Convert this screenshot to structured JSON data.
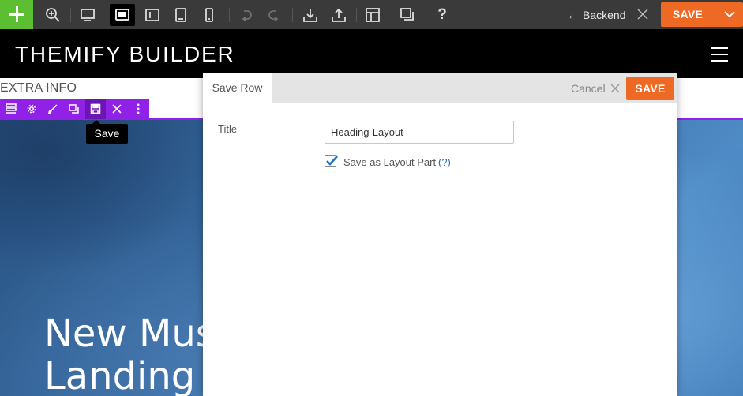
{
  "colors": {
    "toolbar_bg": "#3a3a3a",
    "add_green": "#5cbe31",
    "accent_orange": "#ee6a24",
    "row_purple": "#9221e8"
  },
  "toolbar": {
    "icons": [
      "plus-icon",
      "zoom-in-icon",
      "desktop-icon",
      "tablet-landscape-icon",
      "tablet-portrait-icon",
      "mobile-icon",
      "undo-icon",
      "redo-icon",
      "import-icon",
      "export-icon",
      "layouts-icon",
      "duplicate-icon",
      "help-icon"
    ],
    "help_label": "?",
    "backend_arrow": "←",
    "backend_label": "Backend",
    "save_label": "SAVE"
  },
  "site": {
    "title": "THEMIFY BUILDER",
    "extra_info": "EXTRA INFO"
  },
  "row_toolbar": {
    "icons": [
      "rows-icon",
      "gear-icon",
      "brush-icon",
      "duplicate-icon",
      "save-icon",
      "close-icon",
      "more-icon"
    ],
    "tooltip": "Save"
  },
  "hero": {
    "line1": "New Music",
    "line2": "Landing Page"
  },
  "modal": {
    "tab": "Save Row",
    "cancel_label": "Cancel",
    "save_label": "SAVE",
    "title_label": "Title",
    "title_value": "Heading-Layout",
    "checkbox_label": "Save as Layout Part",
    "checkbox_checked": true,
    "help_link": "(?)"
  }
}
